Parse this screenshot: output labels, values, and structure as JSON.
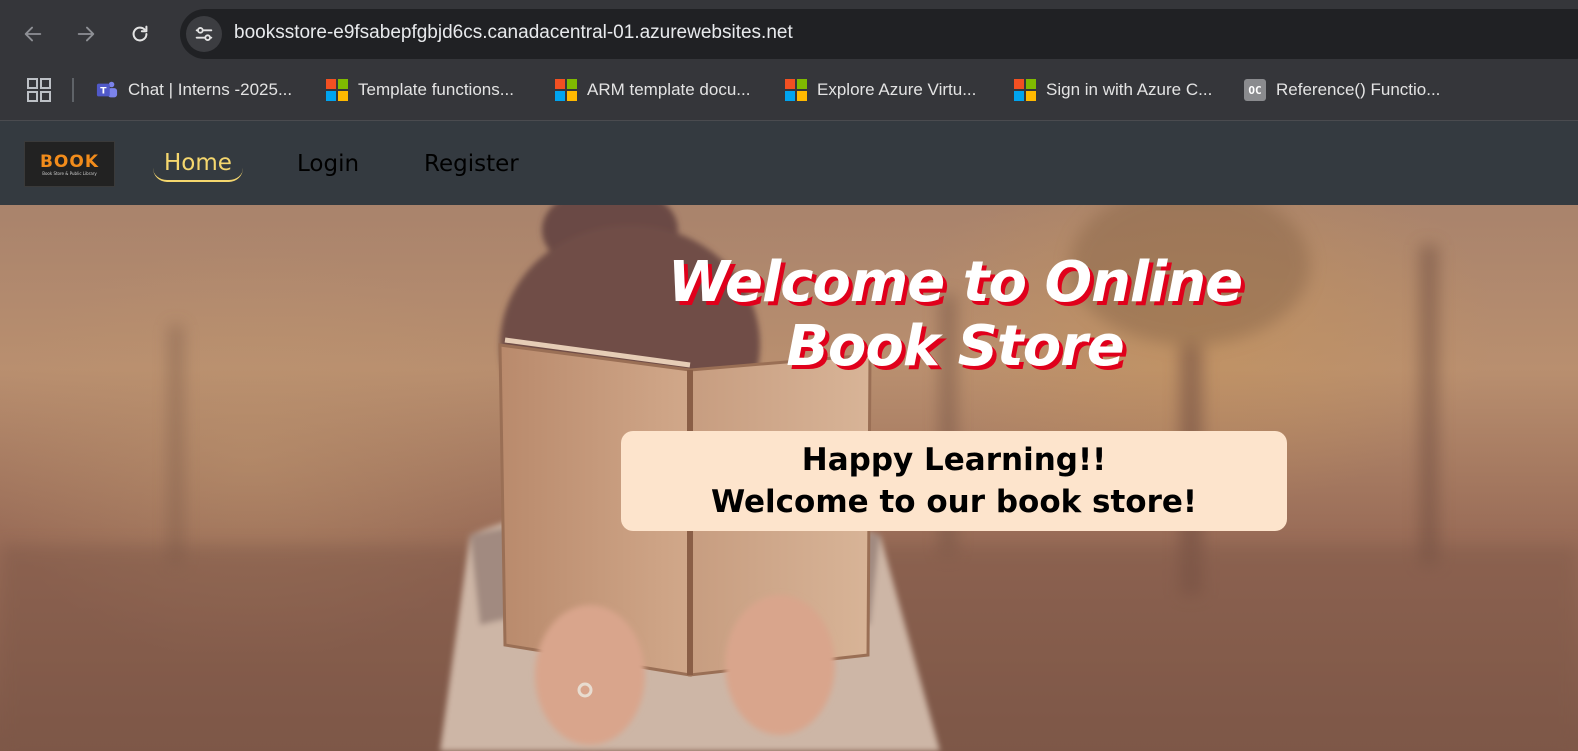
{
  "browser": {
    "url": "booksstore-e9fsabepfgbjd6cs.canadacentral-01.azurewebsites.net",
    "bookmarks": [
      {
        "label": "Chat | Interns -2025...",
        "icon": "teams-icon"
      },
      {
        "label": "Template functions...",
        "icon": "microsoft-icon"
      },
      {
        "label": "ARM template docu...",
        "icon": "microsoft-icon"
      },
      {
        "label": "Explore Azure Virtu...",
        "icon": "microsoft-icon"
      },
      {
        "label": "Sign in with Azure C...",
        "icon": "microsoft-icon"
      },
      {
        "label": "Reference() Functio...",
        "icon": "oc-icon",
        "icon_text": "OC"
      }
    ]
  },
  "site": {
    "logo": {
      "word": "BOOK",
      "tagline": "Book Store & Public Library"
    },
    "nav": {
      "home": "Home",
      "login": "Login",
      "register": "Register"
    },
    "hero": {
      "title": "Welcome to Online\nBook Store",
      "card_line1": "Happy Learning!!",
      "card_line2": "Welcome to our book store!"
    }
  },
  "colors": {
    "nav_bg": "#343a40",
    "nav_active": "#f5d76e",
    "title_shadow": "#e0001b",
    "card_bg": "#fde4cc"
  }
}
